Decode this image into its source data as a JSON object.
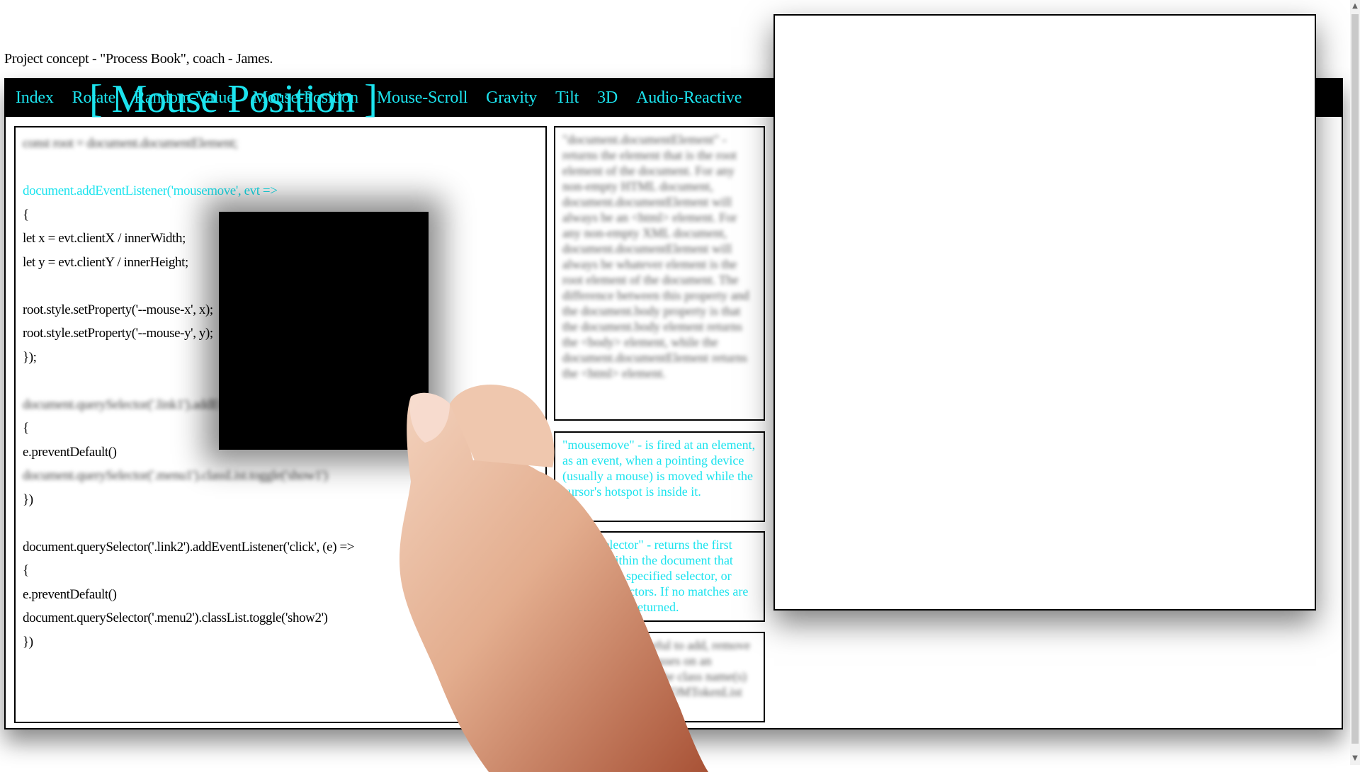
{
  "caption": "Project concept - \"Process Book\", coach - James.",
  "nav": {
    "items": [
      "Index",
      "Rotate",
      "Random-Value",
      "Mouse-Position",
      "Mouse-Scroll",
      "Gravity",
      "Tilt",
      "3D",
      "Audio-Reactive"
    ]
  },
  "heading": "[ Mouse Position ]",
  "code": {
    "lines": [
      "const root = document.documentElement;",
      "",
      "document.addEventListener('mousemove', evt =>",
      "{",
      "let x = evt.clientX / innerWidth;",
      "let y = evt.clientY / innerHeight;",
      "",
      "root.style.setProperty('--mouse-x', x);",
      "root.style.setProperty('--mouse-y', y);",
      "});",
      "",
      "document.querySelector('.link1').addEventListener('click', (e) =>",
      "{",
      "e.preventDefault()",
      "document.querySelector('.menu1').classList.toggle('show1')",
      "})",
      "",
      "document.querySelector('.link2').addEventListener('click', (e) =>",
      "{",
      "e.preventDefault()",
      "document.querySelector('.menu2').classList.toggle('show2')",
      "})"
    ]
  },
  "info": {
    "box1": "\"document.documentElement\" - returns the element that is the root element of the document. For any non-empty HTML document, document.documentElement will always be an <html> element. For any non-empty XML document, document.documentElement will always be whatever element is the root element of the document. The difference between this property and the document.body property is that the document.body element returns the <body> element, while the document.documentElement returns the <html> element.",
    "box2": "\"mousemove\" - is fired at an element, as an event, when a pointing device (usually a mouse) is moved while the cursor's hotspot is inside it.",
    "box3": "\"querySelector\" - returns the first element within the document that matches the specified selector, or group of selectors. If no matches are found, null is returned.",
    "box4": "\"classList\" - is useful to add, remove and toggle CSS classes on an element. It returns the class name(s) of an element, as a DOMTokenList object."
  },
  "colors": {
    "accent": "#1ce3ee",
    "nav_bg": "#000000"
  }
}
